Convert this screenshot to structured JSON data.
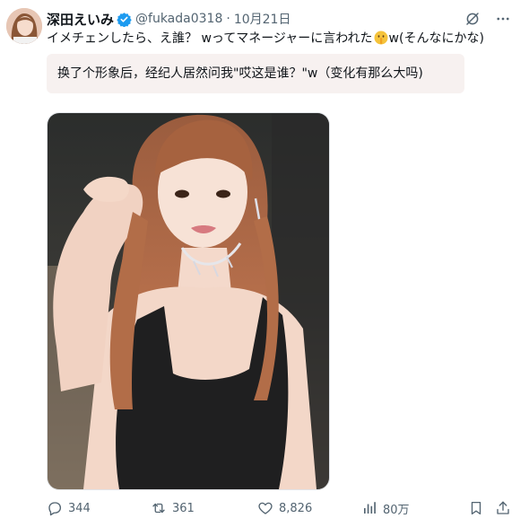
{
  "author": {
    "name": "深田えいみ",
    "handle": "@fukada0318",
    "date": "10月21日"
  },
  "tweet": {
    "text_before_emoji": "イメチェンしたら、え誰？ wってマネージャーに言われた",
    "emoji": "shushing-face-emoji",
    "text_after_emoji": "w(そんなにかな)"
  },
  "translation": {
    "text": "换了个形象后，经纪人居然问我\"哎这是谁？\"w（变化有那么大吗)"
  },
  "actions": {
    "replies": "344",
    "retweets": "361",
    "likes": "8,826",
    "views": "80万"
  },
  "colors": {
    "verified": "#1d9bf0",
    "secondary_text": "#536471",
    "translation_bg": "#f7f1f0"
  }
}
